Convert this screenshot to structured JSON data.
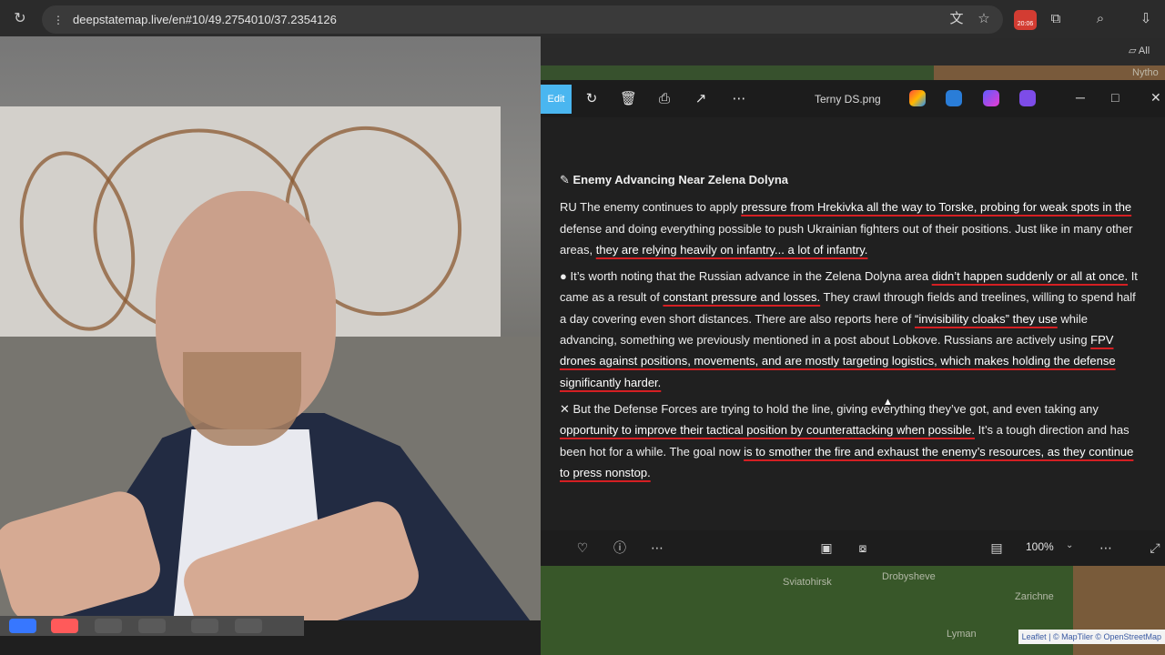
{
  "browser": {
    "url": "deepstatemap.live/en#10/49.2754010/37.2354126",
    "extension_badge": "20:06",
    "bookmarks_folder": "All"
  },
  "viewer": {
    "edit_label": "Edit",
    "filename": "Terny DS.png",
    "zoom": "100%"
  },
  "post": {
    "title": "Enemy Advancing Near Zelena Dolyna",
    "paragraph_1": {
      "prefix": "RU The enemy continues to apply ",
      "underline_1": "pressure from Hrekivka all the way to Torske, probing for weak spots in the",
      "middle": " defense and doing everything possible to push Ukrainian fighters out of their positions. Just like in many other areas, ",
      "underline_2": "they are relying heavily on infantry... a lot of infantry."
    },
    "paragraph_2": {
      "lead": "● It’s worth noting that the Russian advance in the Zelena Dolyna area ",
      "underline_1": "didn’t happen suddenly or all at once.",
      "middle_1": " It came as a result of ",
      "underline_2": "constant pressure and losses.",
      "middle_2": " They crawl through fields and treelines, willing to spend half a day covering even short distances. There are also reports here of ",
      "underline_3": "“invisibility cloaks” they use",
      "middle_3": " while advancing, something we previously mentioned in a post about Lobkove. Russians are actively using ",
      "underline_4": "FPV drones against positions, movements, and are mostly targeting logistics, which makes holding the defense significantly harder."
    },
    "paragraph_3": {
      "lead": "✕ But the Defense Forces are trying to hold the line, giving everything they’ve got, and even taking any ",
      "underline_1": "opportunity to improve their tactical position by counterattacking when possible.",
      "middle": " It’s a tough direction and has been hot for a while. The goal now ",
      "underline_2": "is to smother the fire and exhaust the enemy’s resources, as they continue to press nonstop."
    }
  },
  "map": {
    "labels": {
      "top_right": "Nytho",
      "bottom_1": "Drobysheve",
      "bottom_2": "Sviatohirsk",
      "bottom_3": "Zarichne",
      "bottom_4": "Lyman"
    },
    "attribution": "Leaflet | © MapTiler © OpenStreetMap"
  },
  "icons": {
    "reload": "refresh-icon",
    "site": "site-info-icon",
    "translate": "translate-icon",
    "bookmark": "star-icon",
    "extensions": "extensions-icon",
    "search": "search-icon",
    "downloads": "download-icon"
  }
}
